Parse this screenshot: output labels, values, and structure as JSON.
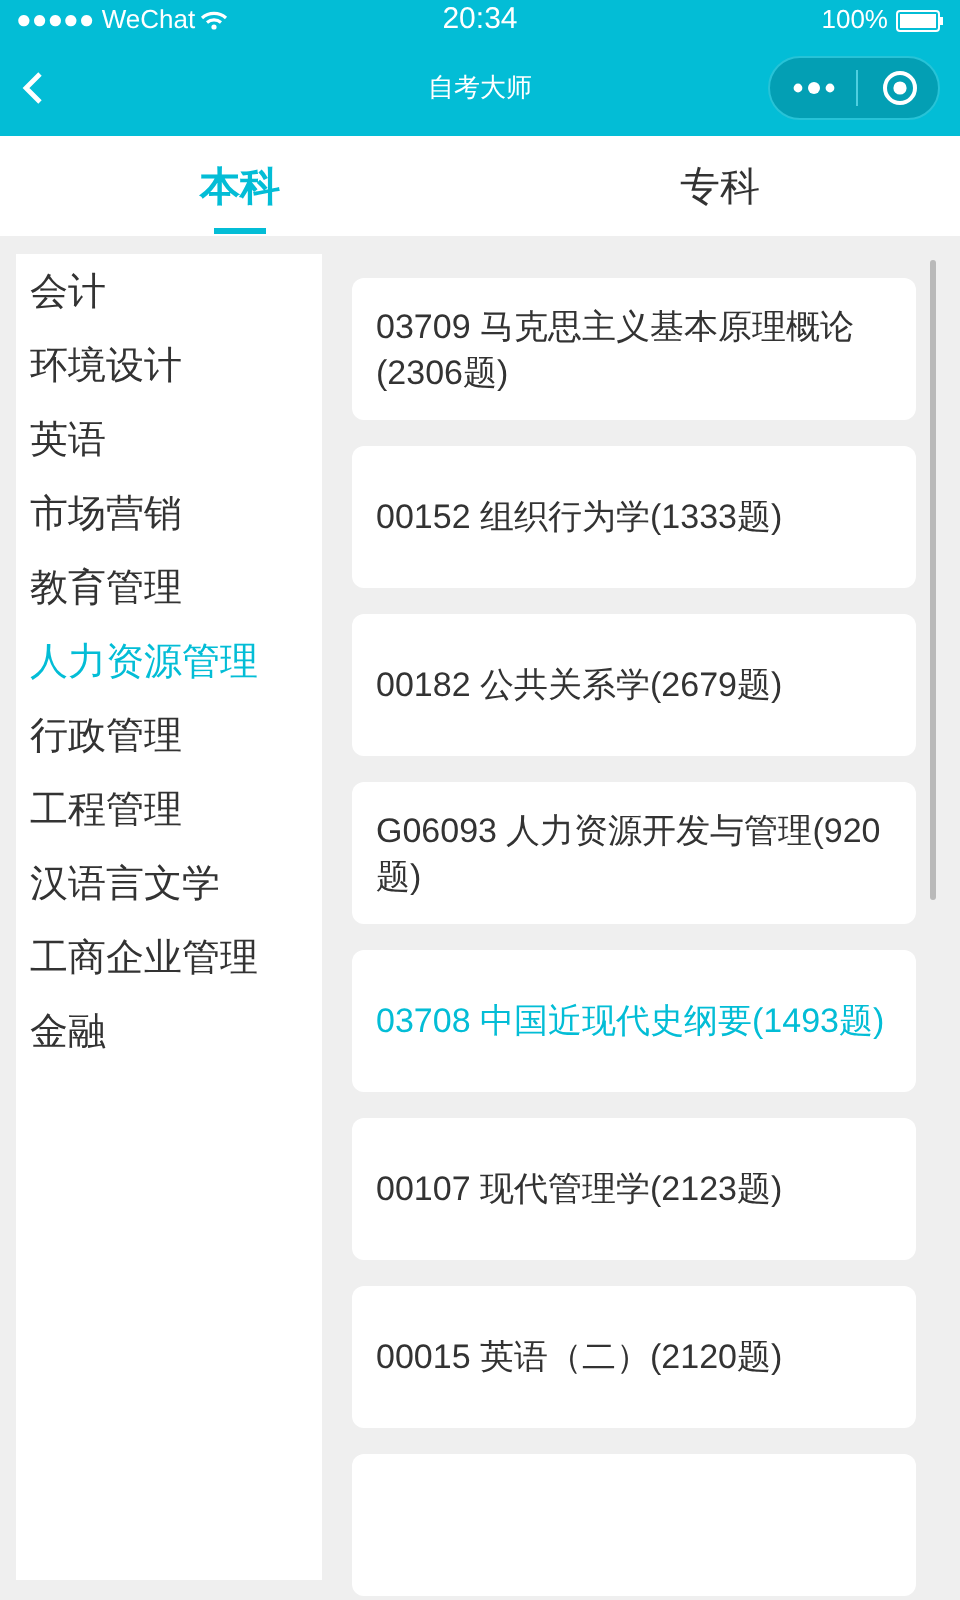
{
  "status_bar": {
    "carrier": "●●●●● WeChat",
    "time": "20:34",
    "battery": "100%"
  },
  "nav_bar": {
    "title": "自考大师"
  },
  "tabs": [
    {
      "label": "本科",
      "selected": true
    },
    {
      "label": "专科",
      "selected": false
    }
  ],
  "sidebar": {
    "items": [
      {
        "label": "会计",
        "selected": false
      },
      {
        "label": "环境设计",
        "selected": false
      },
      {
        "label": "英语",
        "selected": false
      },
      {
        "label": "市场营销",
        "selected": false
      },
      {
        "label": "教育管理",
        "selected": false
      },
      {
        "label": "人力资源管理",
        "selected": true
      },
      {
        "label": "行政管理",
        "selected": false
      },
      {
        "label": "工程管理",
        "selected": false
      },
      {
        "label": "汉语言文学",
        "selected": false
      },
      {
        "label": "工商企业管理",
        "selected": false
      },
      {
        "label": "金融",
        "selected": false
      }
    ]
  },
  "courses": [
    {
      "title": "03709 马克思主义基本原理概论(2306题)",
      "selected": false
    },
    {
      "title": "00152 组织行为学(1333题)",
      "selected": false
    },
    {
      "title": "00182 公共关系学(2679题)",
      "selected": false
    },
    {
      "title": "G06093 人力资源开发与管理(920题)",
      "selected": false
    },
    {
      "title": "03708 中国近现代史纲要(1493题)",
      "selected": true
    },
    {
      "title": "00107 现代管理学(2123题)",
      "selected": false
    },
    {
      "title": "00015 英语（二）(2120题)",
      "selected": false
    }
  ]
}
